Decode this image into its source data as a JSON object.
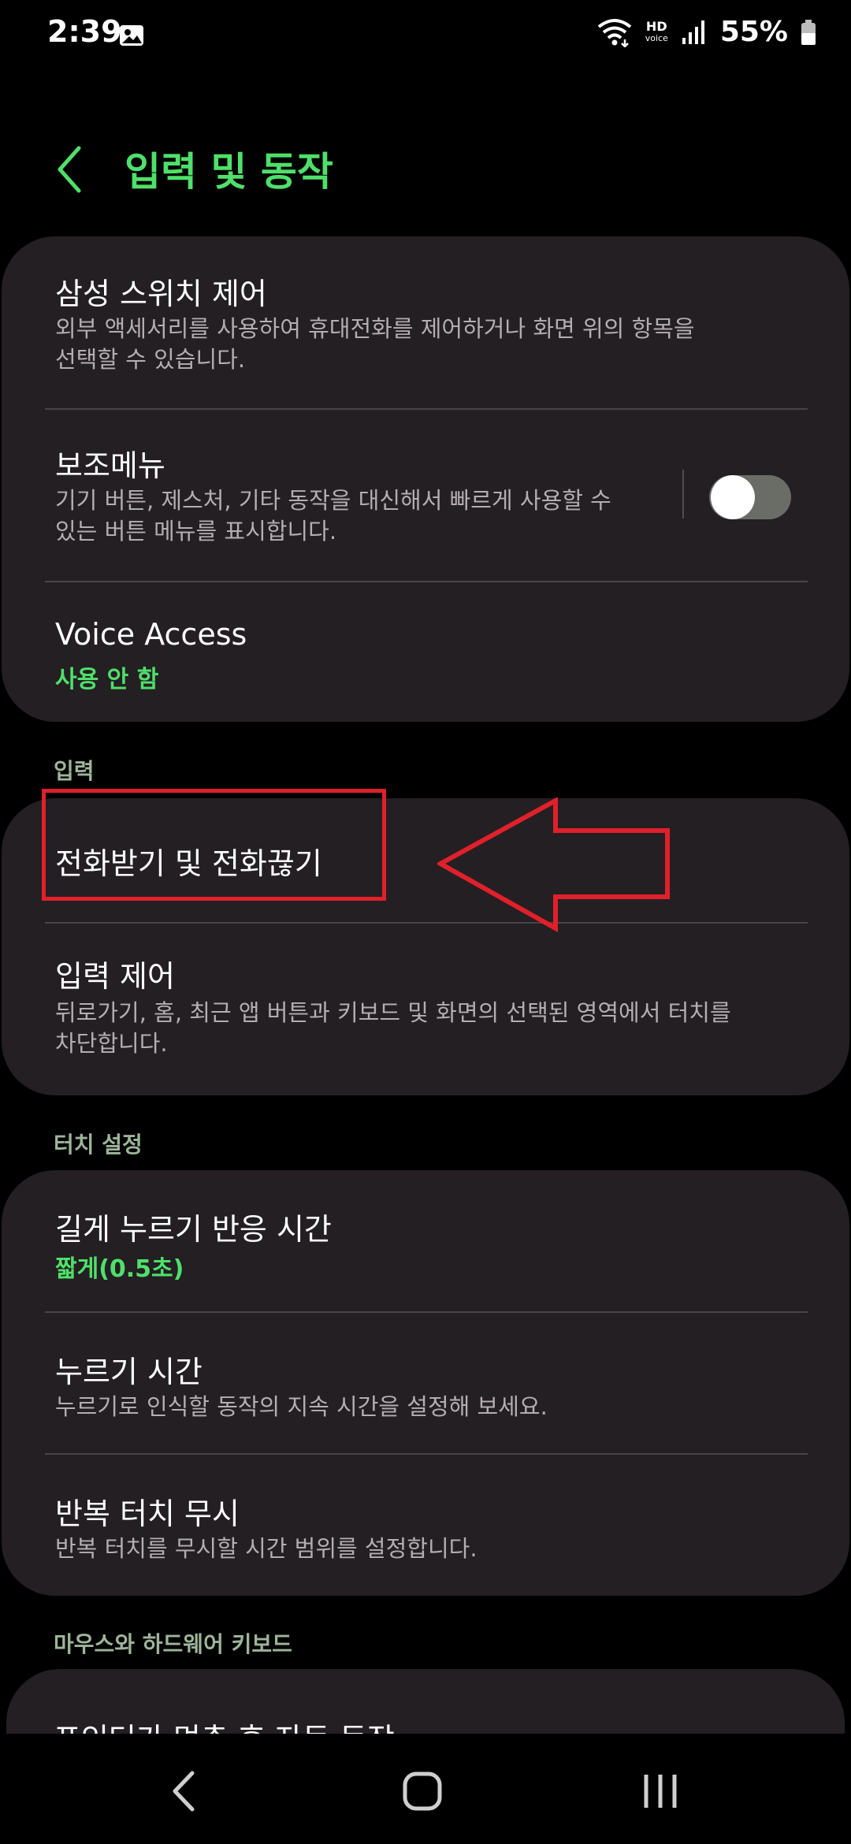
{
  "status_bar": {
    "time": "2:39",
    "battery_percent": "55%",
    "hd_top": "HD",
    "hd_bottom": "voice"
  },
  "header": {
    "title": "입력 및 동작"
  },
  "card1": {
    "items": [
      {
        "title": "삼성 스위치 제어",
        "subtitle_line1": "외부 액세서리를 사용하여 휴대전화를 제어하거나 화면 위의 항목을",
        "subtitle_line2": "선택할 수 있습니다."
      },
      {
        "title": "보조메뉴",
        "subtitle_line1": "기기 버튼, 제스처, 기타 동작을 대신해서 빠르게 사용할 수",
        "subtitle_line2": "있는 버튼 메뉴를 표시합니다.",
        "toggle_on": false
      },
      {
        "title": "Voice Access",
        "status": "사용 안 함"
      }
    ]
  },
  "section_input": {
    "label": "입력",
    "items": [
      {
        "title": "전화받기 및 전화끊기"
      },
      {
        "title": "입력 제어",
        "subtitle_line1": "뒤로가기, 홈, 최근 앱 버튼과 키보드 및 화면의 선택된 영역에서 터치를",
        "subtitle_line2": "차단합니다."
      }
    ]
  },
  "section_touch": {
    "label": "터치 설정",
    "items": [
      {
        "title": "길게 누르기 반응 시간",
        "status": "짧게(0.5초)"
      },
      {
        "title": "누르기 시간",
        "subtitle_line1": "누르기로 인식할 동작의 지속 시간을 설정해 보세요."
      },
      {
        "title": "반복 터치 무시",
        "subtitle_line1": "반복 터치를 무시할 시간 범위를 설정합니다."
      }
    ]
  },
  "section_mouse": {
    "label": "마우스와 하드웨어 키보드",
    "items": [
      {
        "title": "포인터가 멈춘 후 자동 동작"
      }
    ]
  },
  "colors": {
    "accent_green": "#4ee06a",
    "card_bg": "#241f23",
    "annotation_red": "#e0202a"
  }
}
